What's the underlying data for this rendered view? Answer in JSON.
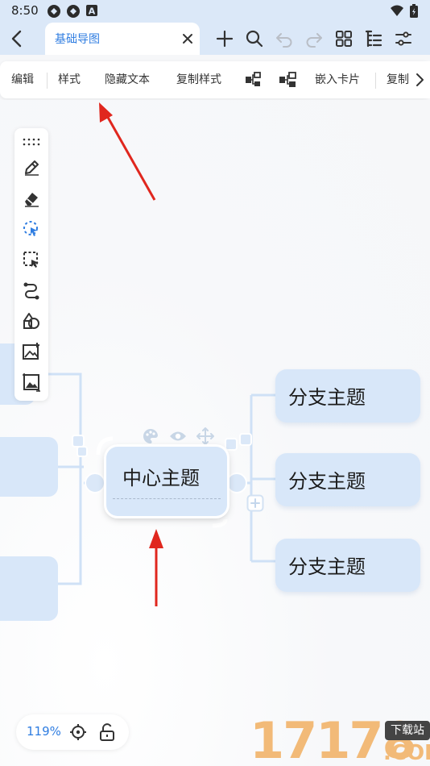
{
  "status_bar": {
    "time": "8:50"
  },
  "topbar": {
    "tab_title": "基础导图",
    "accent": "#2f7de1",
    "icons": [
      "back-icon",
      "close-icon",
      "add-icon",
      "search-icon",
      "undo-icon",
      "redo-icon",
      "grid-icon",
      "outline-icon",
      "settings-icon"
    ]
  },
  "toolbar": {
    "items": [
      "编辑",
      "样式",
      "隐藏文本",
      "复制样式",
      "嵌入卡片",
      "复制"
    ],
    "icons": [
      "child-node-icon",
      "sibling-node-icon",
      "chevron-right-icon"
    ]
  },
  "palette": {
    "tools": [
      "drag-handle-icon",
      "pen-icon",
      "eraser-icon",
      "lasso-icon",
      "select-icon",
      "connector-icon",
      "shape-icon",
      "insert-image-icon",
      "image-icon"
    ]
  },
  "mindmap": {
    "center": "中心主题",
    "branches": [
      "分支主题",
      "分支主题",
      "分支主题"
    ],
    "node_colors": {
      "fill": "#d8e7f9",
      "line": "#cfe1f6"
    }
  },
  "zoom": {
    "level": "119%"
  },
  "watermark": {
    "digits": "17178",
    "badge": "下载站",
    "com": ".COM"
  }
}
